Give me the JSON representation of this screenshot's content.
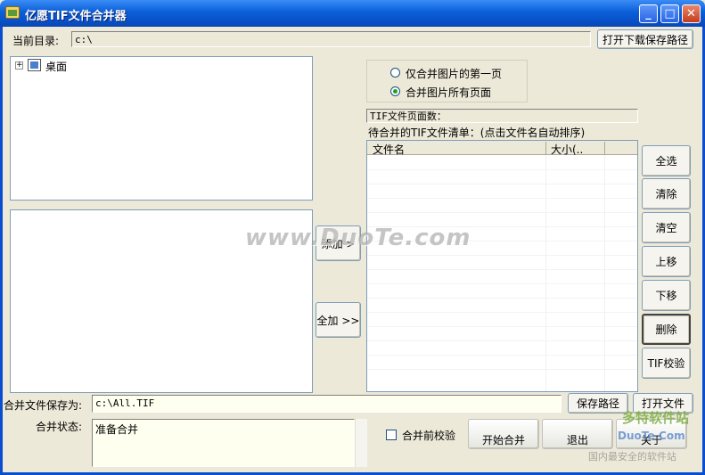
{
  "window": {
    "title": "亿愿TIF文件合并器"
  },
  "current_dir": {
    "label": "当前目录:",
    "value": "c:\\",
    "open_button": "打开下载保存路径"
  },
  "tree": {
    "root": "桌面"
  },
  "options": {
    "first_page": "仅合并图片的第一页",
    "all_pages": "合并图片所有页面",
    "selected": "all_pages"
  },
  "page_count_label": "TIF文件页面数：",
  "merge_list": {
    "heading": "待合并的TIF文件清单：(点击文件名自动排序)",
    "columns": [
      "文件名",
      "大小(.."
    ]
  },
  "buttons": {
    "add": "添加 >",
    "add_all": "全加 >>",
    "select_all": "全选",
    "remove": "清除",
    "clear": "清空",
    "move_up": "上移",
    "move_down": "下移",
    "delete": "删除",
    "tif_check": "TIF校验",
    "save_path": "保存路径",
    "open_file": "打开文件",
    "start_merge": "开始合并",
    "exit": "退出",
    "about": "关于"
  },
  "save_file": {
    "label": "合并文件保存为:",
    "value": "c:\\All.TIF"
  },
  "status": {
    "label": "合并状态:",
    "value": "准备合并"
  },
  "verify_before_merge": {
    "label": "合并前校验",
    "checked": false
  },
  "watermarks": {
    "center": "www.DuoTe.com",
    "corner_brand": "多特软件站",
    "corner_url": "DuoTe.Com",
    "corner_slogan": "国内最安全的软件站"
  }
}
